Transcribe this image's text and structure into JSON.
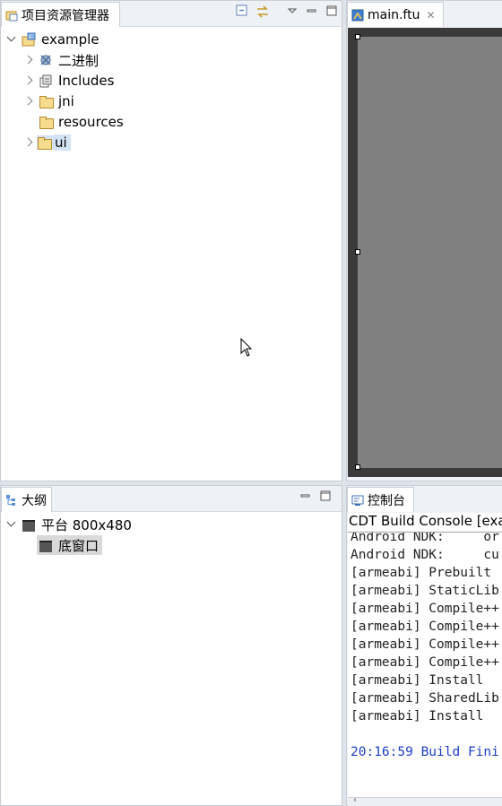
{
  "explorer": {
    "tab_label": "项目资源管理器",
    "tree": {
      "project": "example",
      "children": [
        "二进制",
        "Includes",
        "jni",
        "resources",
        "ui"
      ]
    }
  },
  "editor": {
    "tab_label": "main.ftu"
  },
  "outline": {
    "tab_label": "大纲",
    "platform": "平台 800x480",
    "window": "底窗口"
  },
  "console": {
    "tab_label": "控制台",
    "header": "CDT Build Console [exam",
    "lines": [
      "Android NDK:     or",
      "Android NDK:     cu",
      "[armeabi] Prebuilt",
      "[armeabi] StaticLib",
      "[armeabi] Compile++",
      "[armeabi] Compile++",
      "[armeabi] Compile++",
      "[armeabi] Compile++",
      "[armeabi] Install",
      "[armeabi] SharedLib",
      "[armeabi] Install",
      "",
      "20:16:59 Build Fini"
    ]
  },
  "colors": {
    "selection": "#d3e3f5",
    "canvas": "#808080",
    "console_time": "#1d3fc6"
  }
}
